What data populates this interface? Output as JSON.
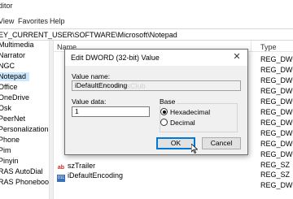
{
  "window": {
    "title_partial": "ditor"
  },
  "menu": {
    "view": "View",
    "favorites": "Favorites",
    "help": "Help"
  },
  "address": {
    "path": "EY_CURRENT_USER\\SOFTWARE\\Microsoft\\Notepad"
  },
  "tree": {
    "items": [
      {
        "label": "Multimedia",
        "selected": false
      },
      {
        "label": "Narrator",
        "selected": false
      },
      {
        "label": "NGC",
        "selected": false
      },
      {
        "label": "Notepad",
        "selected": true
      },
      {
        "label": "Office",
        "selected": false
      },
      {
        "label": "OneDrive",
        "selected": false
      },
      {
        "label": "Osk",
        "selected": false
      },
      {
        "label": "PeerNet",
        "selected": false
      },
      {
        "label": "Personalization",
        "selected": false
      },
      {
        "label": "Phone",
        "selected": false
      },
      {
        "label": "Pim",
        "selected": false
      },
      {
        "label": "Pinyin",
        "selected": false
      },
      {
        "label": "RAS AutoDial",
        "selected": false
      },
      {
        "label": "RAS Phonebook",
        "selected": false
      }
    ]
  },
  "list": {
    "columns": {
      "name": "Name",
      "type": "Type"
    },
    "types": [
      "REG_DWORD",
      "REG_DWORD",
      "REG_DWORD",
      "REG_DWORD",
      "REG_DWORD",
      "REG_DWORD",
      "REG_DWORD",
      "REG_DWORD",
      "REG_DWORD",
      "REG_DWORD",
      "REG_SZ",
      "REG_SZ",
      "REG_DWORD"
    ],
    "rows": [
      {
        "name": "szTrailer",
        "icon": "string-value-icon"
      },
      {
        "name": "iDefaultEncoding",
        "icon": "binary-value-icon"
      }
    ]
  },
  "dialog": {
    "title": "Edit DWORD (32-bit) Value",
    "close_glyph": "✕",
    "value_name_label": "Value name:",
    "value_name": "iDefaultEncoding",
    "value_data_label": "Value data:",
    "value_data": "1",
    "base_label": "Base",
    "hex_label": "Hexadecimal",
    "dec_label": "Decimal",
    "selected_base": "Hexadecimal",
    "ok_label": "OK",
    "cancel_label": "Cancel"
  },
  "watermark": {
    "text": "TheWindowsClub"
  },
  "colors": {
    "selection": "#cce8ff",
    "accent": "#0078d7",
    "dialog_bg": "#f0f0f0"
  }
}
